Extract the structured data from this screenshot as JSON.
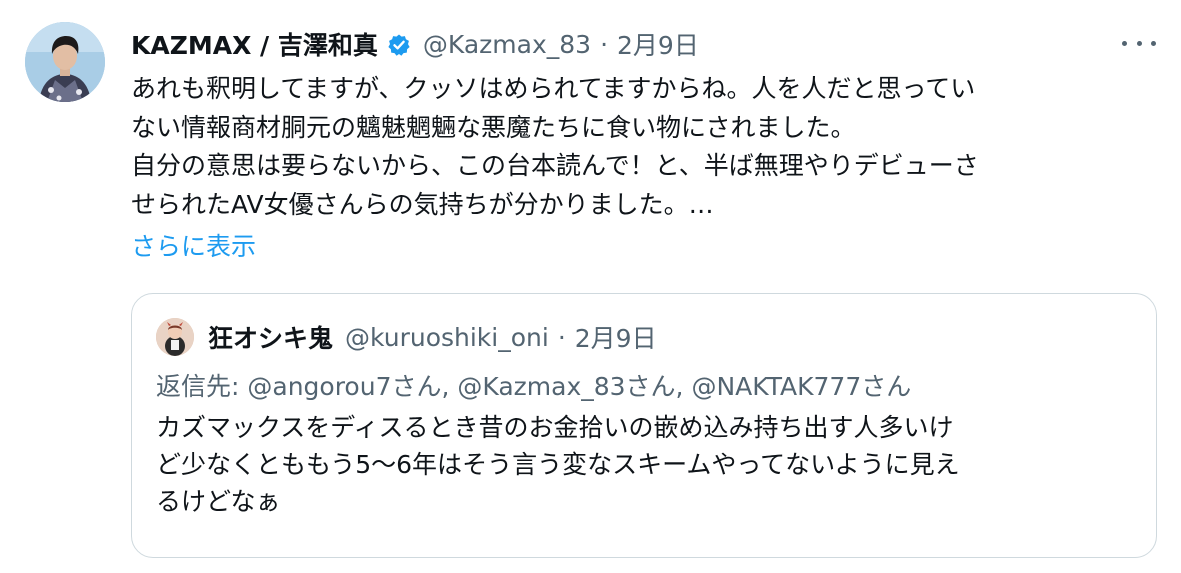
{
  "tweet": {
    "author_name": "KAZMAX / 吉澤和真",
    "handle": "@Kazmax_83",
    "separator": "·",
    "date": "2月9日",
    "body_lines": [
      "あれも釈明してますが、クッソはめられてますからね。人を人だと思ってい",
      "ない情報商材胴元の魑魅魍魎な悪魔たちに食い物にされました。",
      "自分の意思は要らないから、この台本読んで！と、半ば無理やりデビューさ",
      "せられたAV女優さんらの気持ちが分かりました。…"
    ],
    "show_more_label": "さらに表示"
  },
  "quoted_tweet": {
    "author_name": "狂オシキ鬼",
    "handle": "@kuruoshiki_oni",
    "separator": "·",
    "date": "2月9日",
    "reply_prefix": "返信先: ",
    "reply_mentions": "@angorou7さん, @Kazmax_83さん, @NAKTAK777さん",
    "body_lines": [
      "カズマックスをディスるとき昔のお金拾いの嵌め込み持ち出す人多いけ",
      "ど少なくとももう5〜6年はそう言う変なスキームやってないように見え",
      "るけどなぁ"
    ]
  },
  "icons": {
    "verified": "verified-badge-icon",
    "more": "more-options-icon"
  },
  "colors": {
    "text_primary": "#0f1419",
    "text_secondary": "#536471",
    "link": "#1d9bf0",
    "verified": "#1d9bf0",
    "border": "#cfd9de"
  }
}
